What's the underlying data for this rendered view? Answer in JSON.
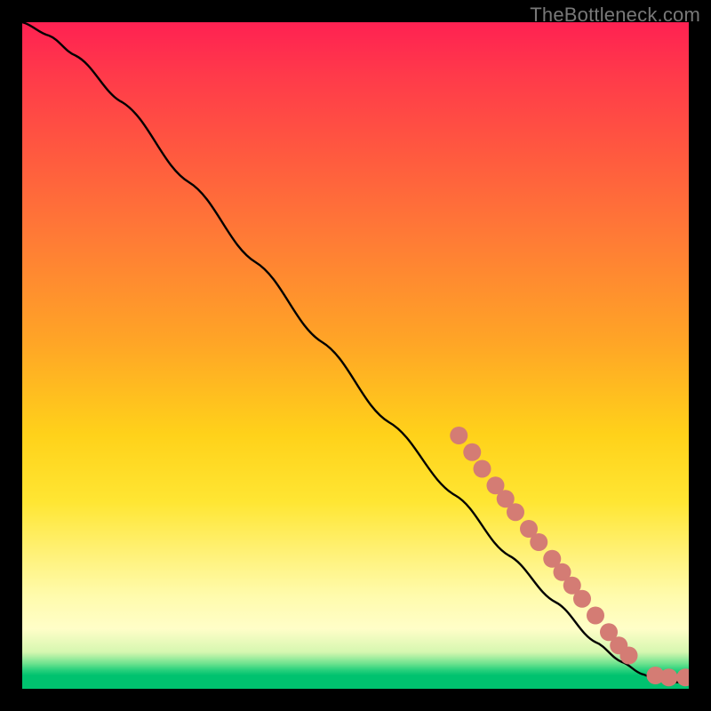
{
  "attribution": "TheBottleneck.com",
  "colors": {
    "background": "#000000",
    "gradient_top": "#ff2152",
    "gradient_mid1": "#ff7a36",
    "gradient_mid2": "#ffd21a",
    "gradient_low": "#fffbac",
    "gradient_green": "#00c26f",
    "curve": "#000000",
    "dot_fill": "#d47c74",
    "dot_stroke": "#a94e46",
    "attribution_text": "#787878"
  },
  "chart_data": {
    "type": "line",
    "title": "",
    "xlabel": "",
    "ylabel": "",
    "xlim": [
      0,
      100
    ],
    "ylim": [
      0,
      100
    ],
    "grid": false,
    "line": {
      "x": [
        0,
        4,
        8,
        15,
        25,
        35,
        45,
        55,
        65,
        73,
        80,
        86,
        90,
        93,
        95,
        97,
        99,
        100
      ],
      "y": [
        100,
        98,
        95,
        88,
        76,
        64,
        52,
        40,
        29,
        20,
        13,
        7,
        4,
        2.2,
        1.4,
        1,
        1,
        1
      ]
    },
    "dots": [
      {
        "x": 65.5,
        "y": 38
      },
      {
        "x": 67.5,
        "y": 35.5
      },
      {
        "x": 69,
        "y": 33
      },
      {
        "x": 71,
        "y": 30.5
      },
      {
        "x": 72.5,
        "y": 28.5
      },
      {
        "x": 74,
        "y": 26.5
      },
      {
        "x": 76,
        "y": 24
      },
      {
        "x": 77.5,
        "y": 22
      },
      {
        "x": 79.5,
        "y": 19.5
      },
      {
        "x": 81,
        "y": 17.5
      },
      {
        "x": 82.5,
        "y": 15.5
      },
      {
        "x": 84,
        "y": 13.5
      },
      {
        "x": 86,
        "y": 11
      },
      {
        "x": 88,
        "y": 8.5
      },
      {
        "x": 89.5,
        "y": 6.5
      },
      {
        "x": 91,
        "y": 5
      },
      {
        "x": 95,
        "y": 2
      },
      {
        "x": 97,
        "y": 1.7
      },
      {
        "x": 99.5,
        "y": 1.7
      }
    ],
    "dot_radius_px": 10
  }
}
